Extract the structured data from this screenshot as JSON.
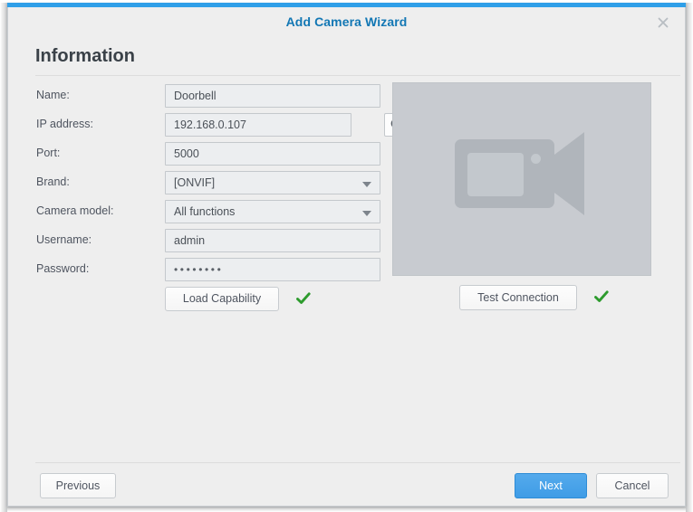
{
  "window": {
    "title": "Add Camera Wizard",
    "close_icon": "close-icon",
    "accent_color": "#2f9fe8",
    "title_color": "#1277b4"
  },
  "page": {
    "heading": "Information"
  },
  "form": {
    "fields": [
      {
        "label": "Name:",
        "value": "Doorbell",
        "type": "text"
      },
      {
        "label": "IP address:",
        "value": "192.168.0.107",
        "type": "text-with-search"
      },
      {
        "label": "Port:",
        "value": "5000",
        "type": "text"
      },
      {
        "label": "Brand:",
        "value": "[ONVIF]",
        "type": "select"
      },
      {
        "label": "Camera model:",
        "value": "All functions",
        "type": "select"
      },
      {
        "label": "Username:",
        "value": "admin",
        "type": "text"
      },
      {
        "label": "Password:",
        "value": "••••••••",
        "type": "password"
      }
    ],
    "search_icon": "search-icon",
    "load_capability_label": "Load Capability",
    "load_capability_status_icon": "check-icon",
    "status_color": "#2d9b2d"
  },
  "preview": {
    "placeholder_icon": "camera-icon",
    "background_color": "#c8cbd0",
    "test_connection_label": "Test Connection",
    "test_connection_status_icon": "check-icon"
  },
  "footer": {
    "previous_label": "Previous",
    "next_label": "Next",
    "cancel_label": "Cancel",
    "next_color": "#45a1e8"
  }
}
